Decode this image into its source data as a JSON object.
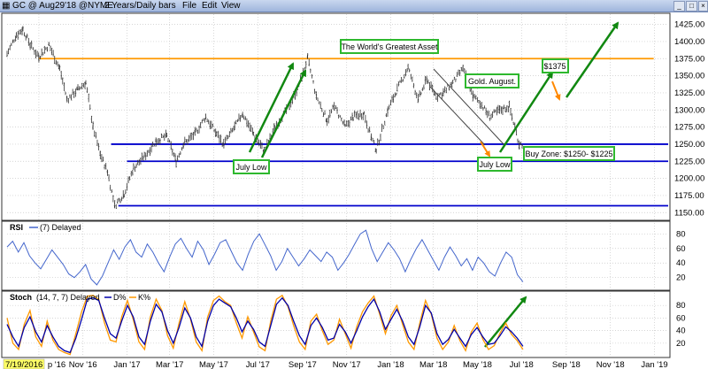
{
  "titlebar": {
    "symbol_text": "GC @ Aug29'18 @NYME",
    "period_text": "2 Years/Daily bars",
    "menu": [
      "File",
      "Edit",
      "View"
    ]
  },
  "colors": {
    "price_bars": "#333333",
    "resistance": "#ff9900",
    "support": "#0000cc",
    "arrow_green": "#118811",
    "arrow_orange": "#ff8800",
    "rsi_line": "#4466cc",
    "stoch_d": "#0000aa",
    "stoch_k": "#ff9900",
    "callout_border": "#2eb82e"
  },
  "chart_data": [
    {
      "type": "ohlc",
      "panel": "price",
      "title": "The World's Greatest Asset",
      "y_ticks": [
        1425,
        1400,
        1375,
        1350,
        1325,
        1300,
        1275,
        1250,
        1225,
        1200,
        1175,
        1150
      ],
      "ylim": [
        1140,
        1440
      ],
      "x_ticks": [
        "p '16",
        "Nov '16",
        "Jan '17",
        "Mar '17",
        "May '17",
        "Jul '17",
        "Sep '17",
        "Nov '17",
        "Jan '18",
        "Mar '18",
        "May '18",
        "Jul '18",
        "Sep '18",
        "Nov '18",
        "Jan '19"
      ],
      "start_date_label": "7/19/2016",
      "price_path": [
        [
          "2016-07-19",
          1382
        ],
        [
          "2016-08-01",
          1410
        ],
        [
          "2016-08-10",
          1418
        ],
        [
          "2016-08-20",
          1395
        ],
        [
          "2016-09-01",
          1378
        ],
        [
          "2016-09-15",
          1395
        ],
        [
          "2016-09-30",
          1360
        ],
        [
          "2016-10-10",
          1315
        ],
        [
          "2016-10-25",
          1330
        ],
        [
          "2016-11-05",
          1340
        ],
        [
          "2016-11-15",
          1275
        ],
        [
          "2016-11-25",
          1235
        ],
        [
          "2016-12-05",
          1210
        ],
        [
          "2016-12-15",
          1160
        ],
        [
          "2016-12-28",
          1178
        ],
        [
          "2017-01-10",
          1215
        ],
        [
          "2017-01-25",
          1232
        ],
        [
          "2017-02-10",
          1255
        ],
        [
          "2017-02-25",
          1262
        ],
        [
          "2017-03-10",
          1225
        ],
        [
          "2017-03-20",
          1250
        ],
        [
          "2017-04-05",
          1265
        ],
        [
          "2017-04-20",
          1290
        ],
        [
          "2017-05-05",
          1265
        ],
        [
          "2017-05-15",
          1250
        ],
        [
          "2017-05-30",
          1275
        ],
        [
          "2017-06-10",
          1295
        ],
        [
          "2017-06-25",
          1265
        ],
        [
          "2017-07-10",
          1240
        ],
        [
          "2017-07-25",
          1275
        ],
        [
          "2017-08-10",
          1300
        ],
        [
          "2017-08-25",
          1330
        ],
        [
          "2017-09-08",
          1375
        ],
        [
          "2017-09-20",
          1320
        ],
        [
          "2017-10-05",
          1285
        ],
        [
          "2017-10-15",
          1305
        ],
        [
          "2017-10-30",
          1275
        ],
        [
          "2017-11-10",
          1290
        ],
        [
          "2017-11-25",
          1295
        ],
        [
          "2017-12-05",
          1260
        ],
        [
          "2017-12-12",
          1242
        ],
        [
          "2017-12-28",
          1300
        ],
        [
          "2018-01-10",
          1330
        ],
        [
          "2018-01-25",
          1362
        ],
        [
          "2018-02-08",
          1315
        ],
        [
          "2018-02-20",
          1345
        ],
        [
          "2018-03-05",
          1320
        ],
        [
          "2018-03-15",
          1325
        ],
        [
          "2018-03-28",
          1340
        ],
        [
          "2018-04-11",
          1360
        ],
        [
          "2018-04-25",
          1320
        ],
        [
          "2018-05-05",
          1310
        ],
        [
          "2018-05-18",
          1290
        ],
        [
          "2018-06-01",
          1300
        ],
        [
          "2018-06-14",
          1305
        ],
        [
          "2018-06-28",
          1250
        ],
        [
          "2018-07-03",
          1250
        ]
      ],
      "horizontal_lines": [
        {
          "value": 1375,
          "color": "#ff9900",
          "from": "2016-09-01",
          "to": "2018-12-31"
        },
        {
          "value": 1250,
          "color": "#0000cc",
          "from": "2016-12-10",
          "to": "2019-01-31"
        },
        {
          "value": 1225,
          "color": "#0000cc",
          "from": "2017-01-01",
          "to": "2019-01-31"
        },
        {
          "value": 1160,
          "color": "#0000cc",
          "from": "2016-12-20",
          "to": "2019-01-31"
        }
      ],
      "annotations": [
        {
          "text": "The World's Greatest Asset",
          "date": "2018-02-15",
          "value": 1412
        },
        {
          "text": "Gold. August.",
          "date": "2018-06-28",
          "value": 1352
        },
        {
          "text": "$1375",
          "date": "2018-09-28",
          "value": 1375
        },
        {
          "text": "July Low",
          "date": "2017-07-25",
          "value": 1209
        },
        {
          "text": "July Low",
          "date": "2018-07-15",
          "value": 1222
        },
        {
          "text": "Buy Zone: $1250- $1225",
          "date": "2018-09-28",
          "value": 1238
        }
      ]
    },
    {
      "type": "line",
      "panel": "rsi",
      "title": "RSI",
      "legend": "(7) Delayed",
      "y_ticks": [
        80,
        60,
        40,
        20
      ],
      "ylim": [
        5,
        95
      ],
      "values": [
        62,
        70,
        55,
        68,
        50,
        40,
        32,
        45,
        58,
        48,
        38,
        25,
        20,
        28,
        38,
        18,
        10,
        22,
        40,
        58,
        45,
        62,
        72,
        55,
        48,
        66,
        55,
        40,
        28,
        48,
        66,
        74,
        60,
        48,
        70,
        58,
        38,
        52,
        68,
        72,
        56,
        40,
        30,
        52,
        70,
        80,
        65,
        50,
        30,
        42,
        60,
        48,
        36,
        46,
        58,
        50,
        42,
        55,
        48,
        30,
        40,
        52,
        66,
        80,
        85,
        60,
        42,
        55,
        68,
        58,
        46,
        28,
        45,
        60,
        72,
        58,
        44,
        30,
        48,
        62,
        50,
        36,
        46,
        30,
        48,
        40,
        28,
        22,
        40,
        55,
        48,
        24,
        14
      ],
      "series_end": "2018-07-03"
    },
    {
      "type": "line",
      "panel": "stochastic",
      "title": "Stoch",
      "legend": "(14, 7, 7) Delayed",
      "series_names": [
        "D%",
        "K%"
      ],
      "y_ticks": [
        80,
        60,
        40,
        20
      ],
      "ylim": [
        0,
        100
      ],
      "d_values": [
        50,
        30,
        15,
        45,
        62,
        38,
        22,
        48,
        30,
        15,
        8,
        5,
        28,
        58,
        90,
        92,
        88,
        60,
        35,
        28,
        55,
        80,
        62,
        30,
        18,
        55,
        82,
        70,
        40,
        20,
        45,
        76,
        60,
        30,
        15,
        55,
        80,
        90,
        84,
        78,
        60,
        38,
        55,
        42,
        22,
        15,
        48,
        82,
        92,
        80,
        55,
        32,
        18,
        48,
        60,
        45,
        25,
        28,
        50,
        38,
        20,
        40,
        62,
        78,
        90,
        70,
        42,
        58,
        74,
        55,
        30,
        18,
        46,
        80,
        68,
        35,
        18,
        26,
        42,
        28,
        15,
        34,
        45,
        30,
        18,
        20,
        32,
        46,
        38,
        28,
        15
      ],
      "k_values": [
        60,
        20,
        10,
        50,
        72,
        30,
        15,
        55,
        25,
        10,
        5,
        2,
        35,
        70,
        95,
        96,
        90,
        52,
        25,
        22,
        62,
        88,
        58,
        22,
        10,
        62,
        90,
        72,
        32,
        12,
        52,
        86,
        58,
        22,
        8,
        62,
        88,
        95,
        86,
        80,
        52,
        28,
        62,
        38,
        14,
        8,
        55,
        90,
        96,
        78,
        48,
        22,
        10,
        55,
        66,
        40,
        18,
        25,
        58,
        35,
        12,
        46,
        70,
        84,
        95,
        66,
        35,
        64,
        80,
        50,
        22,
        10,
        52,
        88,
        66,
        28,
        10,
        22,
        48,
        24,
        8,
        38,
        52,
        26,
        10,
        16,
        36,
        52,
        34,
        24,
        10
      ],
      "series_end": "2018-07-03"
    }
  ]
}
